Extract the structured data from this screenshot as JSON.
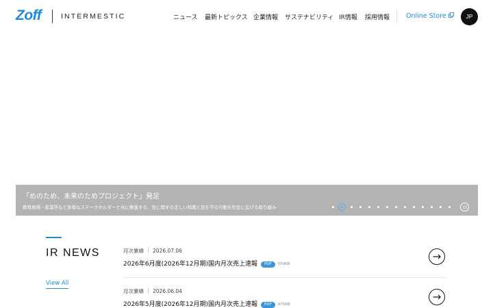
{
  "header": {
    "brand_logo": "Zoff",
    "corp_logo": "INTERMESTIC",
    "nav": [
      {
        "label": "ニュース"
      },
      {
        "label": "最新トピックス"
      },
      {
        "label": "企業情報"
      },
      {
        "label": "サステナビリティ"
      },
      {
        "label": "IR情報"
      },
      {
        "label": "採用情報"
      }
    ],
    "online_store": "Online Store",
    "language": "JP"
  },
  "hero": {
    "caption_title": "「めのため、未来のためプロジェクト」発足",
    "caption_subtitle": "教育現場・産業界など多様なステークホルダーと共に推進する、目に関する正しい知識と目を守る行動を社会に広げる取り組み",
    "slide_count": 14,
    "active_slide": 2
  },
  "ir_news": {
    "heading": "IR NEWS",
    "view_all": "View All",
    "items": [
      {
        "category": "月次業績",
        "date": "2026.07.06",
        "title": "2026年6月度(2026年12月期)国内月次売上速報",
        "badge": "PDF",
        "size": "559KB"
      },
      {
        "category": "月次業績",
        "date": "2026.06.04",
        "title": "2026年5月度(2026年12月期)国内月次売上速報",
        "badge": "PDF",
        "size": "475KB"
      }
    ]
  },
  "colors": {
    "accent": "#1f8ad6",
    "caption_bg": "#b3b3b3",
    "pdf_badge": "#3b95dc"
  },
  "icons": [
    "external-link-icon",
    "pause-icon",
    "arrow-right-icon"
  ]
}
